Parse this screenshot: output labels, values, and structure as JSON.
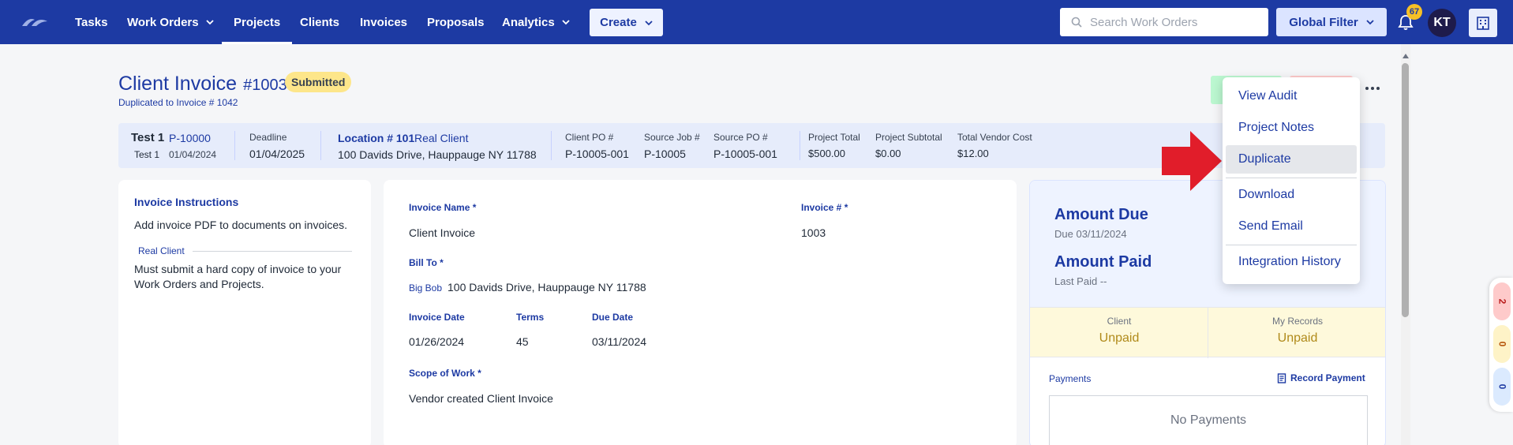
{
  "nav": {
    "items": [
      {
        "label": "Tasks"
      },
      {
        "label": "Work Orders"
      },
      {
        "label": "Projects"
      },
      {
        "label": "Clients"
      },
      {
        "label": "Invoices"
      },
      {
        "label": "Proposals"
      },
      {
        "label": "Analytics"
      }
    ],
    "active": "Projects",
    "create_label": "Create",
    "search_placeholder": "Search Work Orders",
    "global_filter_label": "Global Filter",
    "notification_count": "67",
    "avatar_initials": "KT"
  },
  "header": {
    "title": "Client Invoice",
    "number": "#1003",
    "status": "Submitted",
    "subtitle": "Duplicated to Invoice # 1042"
  },
  "info": {
    "project_name": "Test 1",
    "project_code": "P-10000",
    "project_sub": "Test 1",
    "project_date": "01/04/2024",
    "deadline_label": "Deadline",
    "deadline": "01/04/2025",
    "location_label": "Location # 101",
    "location_client": "Real Client",
    "location_address": "100 Davids Drive, Hauppauge NY 11788",
    "client_po_label": "Client PO #",
    "client_po": "P-10005-001",
    "source_job_label": "Source Job #",
    "source_job": "P-10005",
    "source_po_label": "Source PO #",
    "source_po": "P-10005-001",
    "project_total_label": "Project Total",
    "project_total": "$500.00",
    "project_subtotal_label": "Project Subtotal",
    "project_subtotal": "$0.00",
    "total_vendor_cost_label": "Total Vendor Cost",
    "total_vendor_cost": "$12.00"
  },
  "instructions": {
    "title": "Invoice Instructions",
    "text": "Add invoice PDF to documents on invoices.",
    "client_label": "Real Client",
    "client_text": "Must submit a hard copy of invoice to your Work Orders and Projects."
  },
  "invoice": {
    "name_label": "Invoice Name *",
    "name": "Client Invoice",
    "number_label": "Invoice # *",
    "number": "1003",
    "bill_to_label": "Bill To *",
    "bill_to_name": "Big Bob",
    "bill_to_address": "100 Davids Drive, Hauppauge NY 11788",
    "date_label": "Invoice Date",
    "date": "01/26/2024",
    "terms_label": "Terms",
    "terms": "45",
    "due_label": "Due Date",
    "due": "03/11/2024",
    "scope_label": "Scope of Work *",
    "scope": "Vendor created Client Invoice"
  },
  "amounts": {
    "due_title": "Amount Due",
    "due_sub": "Due 03/11/2024",
    "paid_title": "Amount Paid",
    "paid_sub": "Last Paid --",
    "client_label": "Client",
    "client_status": "Unpaid",
    "records_label": "My Records",
    "records_status": "Unpaid",
    "payments_label": "Payments",
    "record_payment": "Record Payment",
    "no_payments": "No Payments"
  },
  "menu": {
    "items": [
      {
        "label": "View Audit"
      },
      {
        "label": "Project Notes"
      },
      {
        "label": "Duplicate"
      },
      {
        "label": "Download"
      },
      {
        "label": "Send Email"
      },
      {
        "label": "Integration History"
      }
    ],
    "highlighted": "Duplicate"
  },
  "side_pills": [
    "2",
    "0",
    "0"
  ],
  "colors": {
    "nav_bg": "#1d3aa3",
    "accent": "#1d3aa3",
    "status_badge": "#fde68a",
    "arrow": "#e11d2a"
  }
}
